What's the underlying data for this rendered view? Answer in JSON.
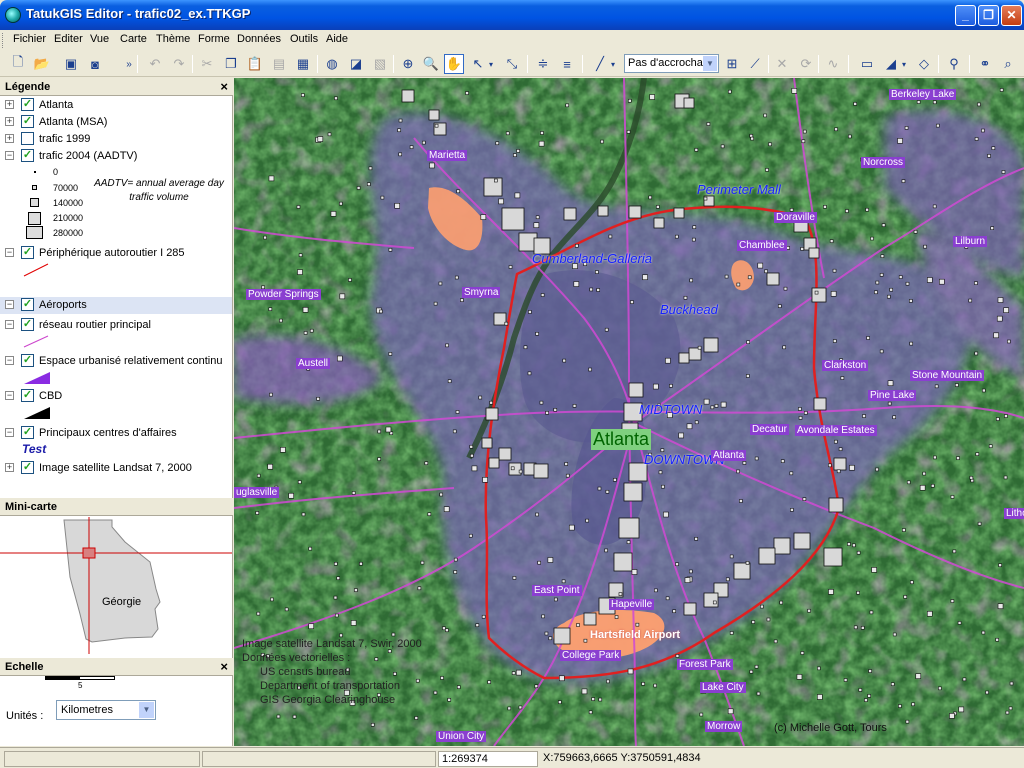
{
  "window": {
    "title": "TatukGIS Editor - trafic02_ex.TTKGP"
  },
  "menu": [
    "Fichier",
    "Editer",
    "Vue",
    "Carte",
    "Thème",
    "Forme",
    "Données",
    "Outils",
    "Aide"
  ],
  "toolbar": {
    "snap_mode": "Pas d'accrocha"
  },
  "legend": {
    "title": "Légende",
    "layers": [
      {
        "name": "Atlanta",
        "checked": true,
        "expandable": true
      },
      {
        "name": "Atlanta (MSA)",
        "checked": true,
        "expandable": true
      },
      {
        "name": "trafic 1999",
        "checked": false,
        "expandable": true
      },
      {
        "name": "trafic 2004 (AADTV)",
        "checked": true,
        "expandable": true,
        "expanded": true
      }
    ],
    "traffic_classes": [
      "0",
      "70000",
      "140000",
      "210000",
      "280000"
    ],
    "traffic_note": "AADTV= annual average day traffic volume",
    "layers2": [
      {
        "name": "Périphérique autoroutier  I 285",
        "checked": true
      },
      {
        "name": "Aéroports",
        "checked": true,
        "selected": true
      },
      {
        "name": "réseau routier principal",
        "checked": true
      },
      {
        "name": "Espace urbanisé relativement continu",
        "checked": true
      },
      {
        "name": "CBD",
        "checked": true
      },
      {
        "name": "Principaux centres d'affaires",
        "checked": true
      },
      {
        "name": "Image satellite Landsat 7, 2000",
        "checked": true
      }
    ],
    "centres_sample": "Test"
  },
  "minimap": {
    "title": "Mini-carte",
    "label": "Géorgie"
  },
  "scale": {
    "title": "Echelle",
    "bar_label": "5",
    "units_label": "Unités :",
    "units_value": "Kilometres"
  },
  "map": {
    "labels": {
      "berkeley": "Berkeley Lake",
      "norcross": "Norcross",
      "perimeter": "Perimeter Mall",
      "doraville": "Doraville",
      "chamblee": "Chamblee",
      "lilburn": "Lilburn",
      "marietta": "Marietta",
      "cumberland": "Cumberland-Galleria",
      "powder": "Powder Springs",
      "smyrna": "Smyrna",
      "buckhead": "Buckhead",
      "austell": "Austell",
      "clarkston": "Clarkston",
      "stone": "Stone Mountain",
      "pine": "Pine Lake",
      "midtown": "MIDTOWN",
      "atlanta_big": "Atlanta",
      "downtown": "DOWNTOWN",
      "decatur": "Decatur",
      "avondale": "Avondale Estates",
      "atlanta_small": "Atlanta",
      "douglas": "uglasville",
      "lithonia": "Litho",
      "eastpoint": "East Point",
      "hapeville": "Hapeville",
      "airport": "Hartsfield Airport",
      "college": "College Park",
      "forest": "Forest Park",
      "lake": "Lake City",
      "morrow": "Morrow",
      "union": "Union City"
    },
    "credits": [
      "Image satellite Landsat 7, Swir, 2000",
      "Données vectorielles :",
      "US census bureau",
      "Department of transportation",
      "GIS Georgia Clearinghouse"
    ],
    "author": "(c) Michelle Gott, Tours"
  },
  "status": {
    "scale": "1:269374",
    "coords": "X:759663,6665  Y:3750591,4834"
  }
}
